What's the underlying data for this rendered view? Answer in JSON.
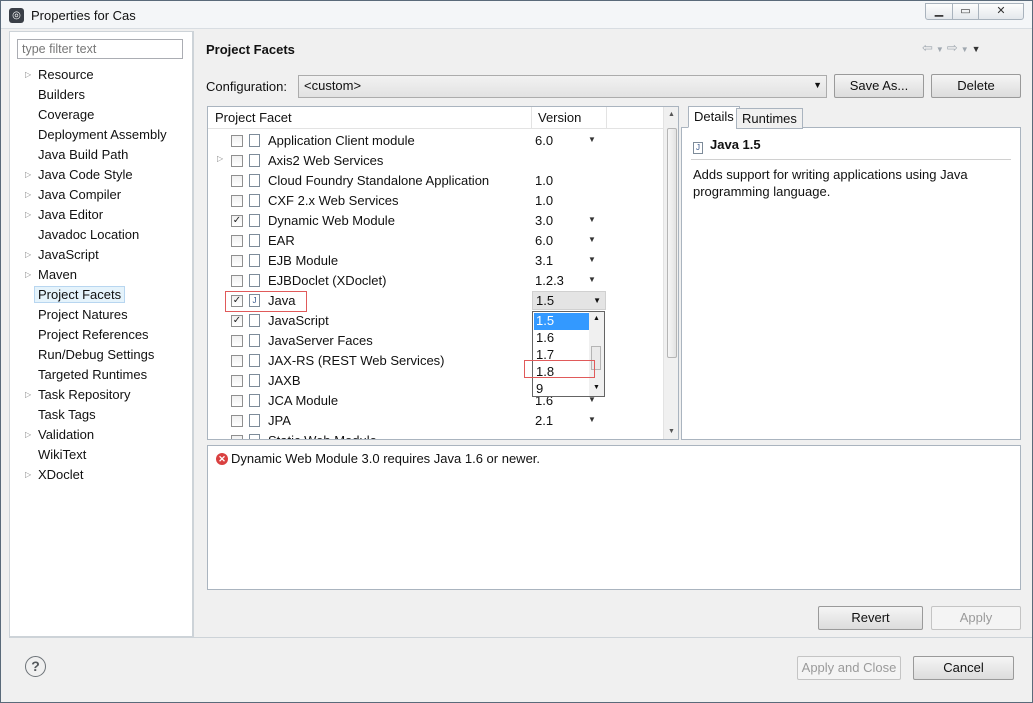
{
  "window": {
    "title": "Properties for Cas",
    "min": "▁",
    "max": "▭",
    "close": "✕"
  },
  "filter": {
    "placeholder": "type filter text"
  },
  "nav": [
    {
      "label": "Resource",
      "expandable": true
    },
    {
      "label": "Builders",
      "expandable": false
    },
    {
      "label": "Coverage",
      "expandable": false
    },
    {
      "label": "Deployment Assembly",
      "expandable": false
    },
    {
      "label": "Java Build Path",
      "expandable": false
    },
    {
      "label": "Java Code Style",
      "expandable": true
    },
    {
      "label": "Java Compiler",
      "expandable": true
    },
    {
      "label": "Java Editor",
      "expandable": true
    },
    {
      "label": "Javadoc Location",
      "expandable": false
    },
    {
      "label": "JavaScript",
      "expandable": true
    },
    {
      "label": "Maven",
      "expandable": true
    },
    {
      "label": "Project Facets",
      "expandable": false,
      "selected": true
    },
    {
      "label": "Project Natures",
      "expandable": false
    },
    {
      "label": "Project References",
      "expandable": false
    },
    {
      "label": "Run/Debug Settings",
      "expandable": false
    },
    {
      "label": "Targeted Runtimes",
      "expandable": false
    },
    {
      "label": "Task Repository",
      "expandable": true
    },
    {
      "label": "Task Tags",
      "expandable": false
    },
    {
      "label": "Validation",
      "expandable": true
    },
    {
      "label": "WikiText",
      "expandable": false
    },
    {
      "label": "XDoclet",
      "expandable": true
    }
  ],
  "page": {
    "title": "Project Facets",
    "config_label": "Configuration:",
    "config_value": "<custom>",
    "save_as": "Save As...",
    "delete": "Delete"
  },
  "facets": {
    "col_facet": "Project Facet",
    "col_version": "Version",
    "rows": [
      {
        "name": "Application Client module",
        "version": "6.0",
        "checked": false,
        "dd": true,
        "exp": false
      },
      {
        "name": "Axis2 Web Services",
        "version": "",
        "checked": false,
        "dd": false,
        "exp": true
      },
      {
        "name": "Cloud Foundry Standalone Application",
        "version": "1.0",
        "checked": false,
        "dd": false,
        "exp": false
      },
      {
        "name": "CXF 2.x Web Services",
        "version": "1.0",
        "checked": false,
        "dd": false,
        "exp": false
      },
      {
        "name": "Dynamic Web Module",
        "version": "3.0",
        "checked": true,
        "dd": true,
        "exp": false
      },
      {
        "name": "EAR",
        "version": "6.0",
        "checked": false,
        "dd": true,
        "exp": false
      },
      {
        "name": "EJB Module",
        "version": "3.1",
        "checked": false,
        "dd": true,
        "exp": false
      },
      {
        "name": "EJBDoclet (XDoclet)",
        "version": "1.2.3",
        "checked": false,
        "dd": true,
        "exp": false
      },
      {
        "name": "Java",
        "version": "",
        "checked": true,
        "dd": false,
        "exp": false
      },
      {
        "name": "JavaScript",
        "version": "",
        "checked": true,
        "dd": false,
        "exp": false
      },
      {
        "name": "JavaServer Faces",
        "version": "",
        "checked": false,
        "dd": false,
        "exp": false
      },
      {
        "name": "JAX-RS (REST Web Services)",
        "version": "",
        "checked": false,
        "dd": false,
        "exp": false
      },
      {
        "name": "JAXB",
        "version": "",
        "checked": false,
        "dd": false,
        "exp": false
      },
      {
        "name": "JCA Module",
        "version": "1.6",
        "checked": false,
        "dd": true,
        "exp": false
      },
      {
        "name": "JPA",
        "version": "2.1",
        "checked": false,
        "dd": true,
        "exp": false
      },
      {
        "name": "Static Web Module",
        "version": "",
        "checked": false,
        "dd": false,
        "exp": false
      }
    ],
    "java_version": "1.5",
    "version_options": [
      "1.5",
      "1.6",
      "1.7",
      "1.8",
      "9"
    ]
  },
  "details": {
    "tab_details": "Details",
    "tab_runtimes": "Runtimes",
    "heading": "Java 1.5",
    "description": "Adds support for writing applications using Java programming language."
  },
  "message": {
    "text": "Dynamic Web Module 3.0 requires Java 1.6 or newer."
  },
  "buttons": {
    "revert": "Revert",
    "apply": "Apply",
    "apply_close": "Apply and Close",
    "cancel": "Cancel",
    "help": "?"
  }
}
